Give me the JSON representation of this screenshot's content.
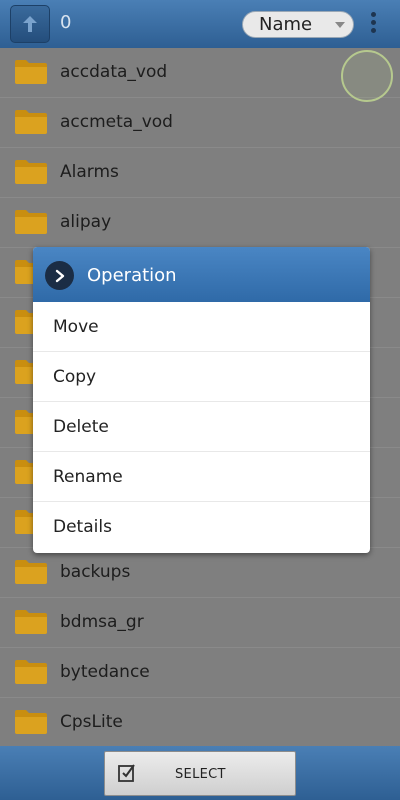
{
  "header": {
    "count": "0",
    "sort": {
      "selected": "Name"
    },
    "icons": {
      "up": "up-arrow-icon",
      "menu": "more-vertical-icon"
    }
  },
  "files": [
    {
      "name": "accdata_vod",
      "icon": "folder-icon"
    },
    {
      "name": "accmeta_vod",
      "icon": "folder-icon"
    },
    {
      "name": "Alarms",
      "icon": "folder-icon"
    },
    {
      "name": "alipay",
      "icon": "folder-icon"
    },
    {
      "name": "",
      "icon": "folder-icon"
    },
    {
      "name": "",
      "icon": "folder-icon"
    },
    {
      "name": "",
      "icon": "folder-icon"
    },
    {
      "name": "",
      "icon": "folder-icon"
    },
    {
      "name": "",
      "icon": "folder-icon"
    },
    {
      "name": "",
      "icon": "folder-icon"
    },
    {
      "name": "backups",
      "icon": "folder-icon"
    },
    {
      "name": "bdmsa_gr",
      "icon": "folder-icon"
    },
    {
      "name": "bytedance",
      "icon": "folder-icon"
    },
    {
      "name": "CpsLite",
      "icon": "folder-icon"
    }
  ],
  "dialog": {
    "title": "Operation",
    "icon": "chevron-right-icon",
    "items": [
      "Move",
      "Copy",
      "Delete",
      "Rename",
      "Details"
    ]
  },
  "footer": {
    "select_label": "SELECT",
    "select_icon": "checkbox-edit-icon"
  },
  "colors": {
    "bar": "#2e5f93",
    "dialog_header": "#3a78b8",
    "folder": "#d49a16",
    "dim_overlay": "#7f7f7f"
  }
}
